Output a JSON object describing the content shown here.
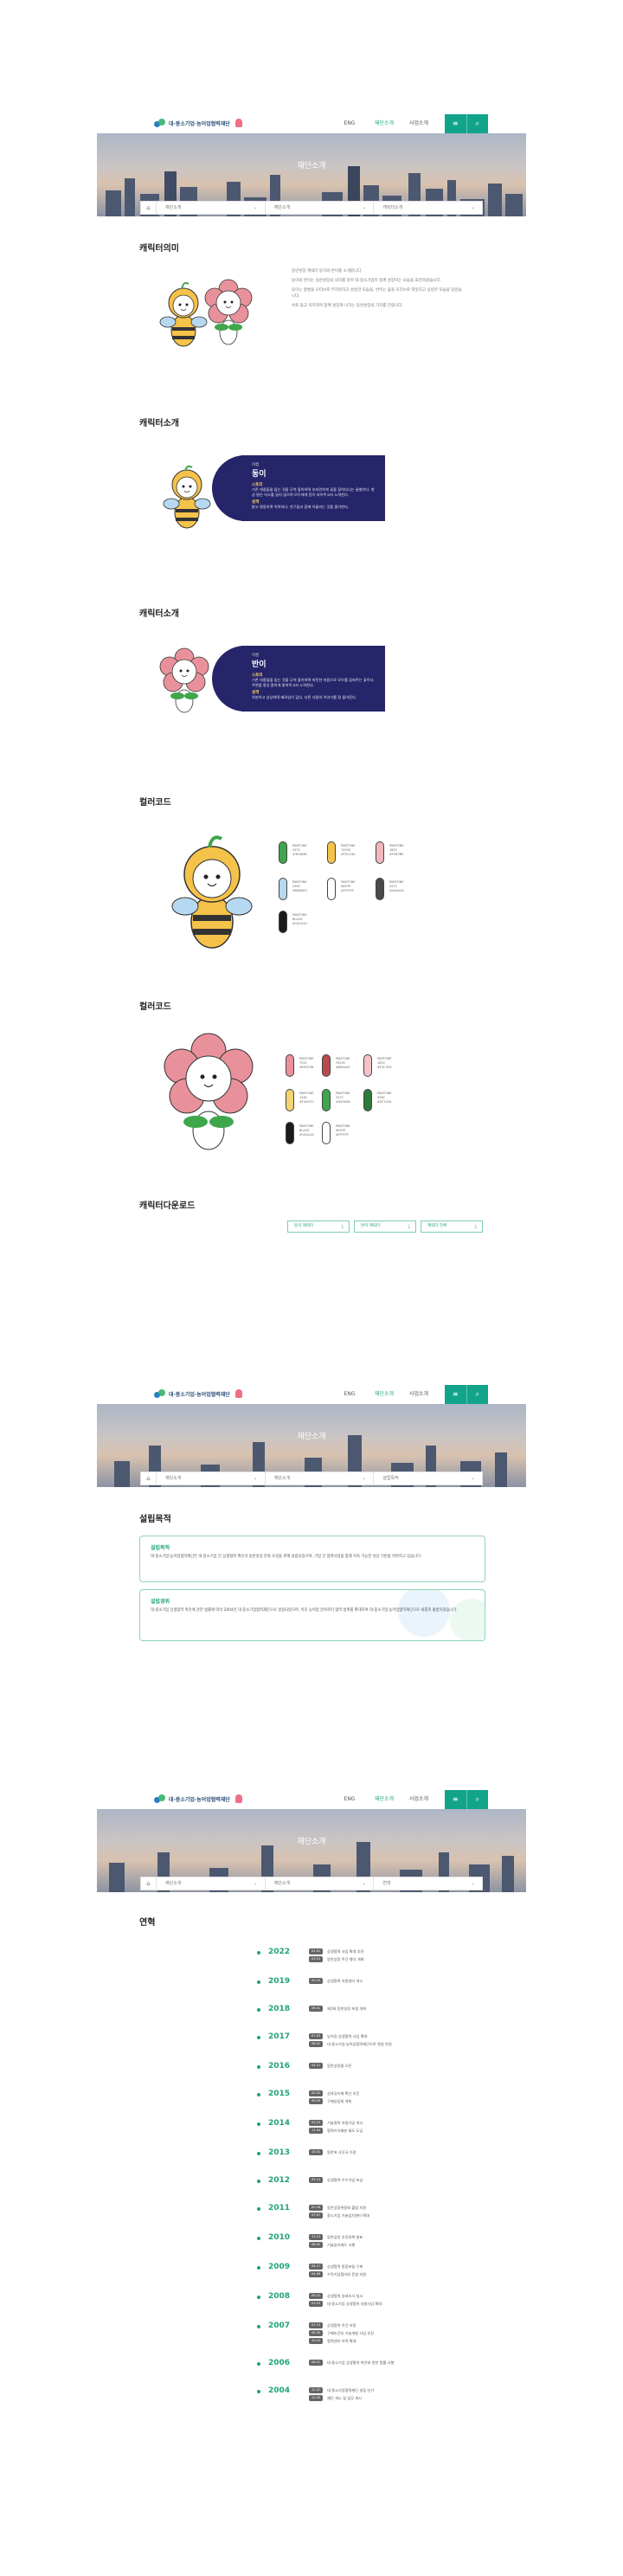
{
  "header": {
    "logo": "대·중소기업·농어업협력재단",
    "nav": [
      "ENG",
      "재단소개",
      "사업소개"
    ]
  },
  "hero": {
    "title": "재단소개"
  },
  "crumb": {
    "items": [
      "재단소개",
      "재단소개",
      "캐릭터소개"
    ]
  },
  "colors": {
    "accent": "#11a48b",
    "green_text": "#1fa37a",
    "navy": "#26256a"
  },
  "sections": {
    "meaning": "캐릭터의미",
    "intro1": "캐릭터소개",
    "intro2": "캐릭터소개",
    "color1": "컬러코드",
    "color2": "컬러코드",
    "download": "캐릭터다운로드",
    "purpose": "설립목적",
    "history": "연혁"
  },
  "meaning_paragraphs": [
    "동반성장 캐릭터 동이와 반이를 소개합니다.",
    "동이와 반이는 동반성장의 의미를 담아 대·중소기업이 함께 성장하는 모습을 표현하였습니다.",
    "동이는 꿀벌을 모티브로 부지런하고 성실한 모습을, 반이는 꽃을 모티브로 따뜻하고 상냥한 모습을 담았습니다.",
    "서로 돕고 의지하며 함께 성장해 나가는 동반성장의 가치를 전합니다."
  ],
  "intro": [
    {
      "tag": "이름",
      "name": "동이",
      "profile_label": "스토리",
      "profile": "기존 대중들을 돕는 것을 무척 좋아하며 부지런하게 꽃을 찾아다니는 꿀벌이다. 항상 밝은 미소를 잃지 않으며 모두에게 힘이 되어주고자 노력한다.",
      "char_label": "성격",
      "char": "밝고 명랑하며 씩씩하다. 친구들과 함께 어울리는 것을 좋아한다."
    },
    {
      "tag": "이름",
      "name": "반이",
      "profile_label": "스토리",
      "profile": "기존 대중들을 돕는 것을 무척 좋아하며 따뜻한 마음으로 모두를 감싸주는 꽃이다. 주변을 항상 환하게 밝혀주고자 노력한다.",
      "char_label": "성격",
      "char": "차분하고 상냥하며 배려심이 깊다. 다른 사람의 이야기를 잘 들어준다."
    }
  ],
  "color_codes_1": [
    {
      "hex": "#3ea64b",
      "text": [
        "PANTONE",
        "347C",
        "#3EA64B"
      ]
    },
    {
      "hex": "#f5c24a",
      "text": [
        "PANTONE",
        "7404C",
        "#F5C24A"
      ]
    },
    {
      "hex": "#f2b7be",
      "text": [
        "PANTONE",
        "182C",
        "#F2B7BE"
      ]
    },
    {
      "hex": "#b6d8f0",
      "text": [
        "PANTONE",
        "290C",
        "#B6D8F0"
      ]
    },
    {
      "hex": "#ffffff",
      "text": [
        "PANTONE",
        "WHITE",
        "#FFFFFF"
      ]
    },
    {
      "hex": "#4a4a4a",
      "text": [
        "PANTONE",
        "447C",
        "#4A4A4A"
      ]
    },
    {
      "hex": "#1a1a1a",
      "text": [
        "PANTONE",
        "BLACK",
        "#1A1A1A"
      ]
    }
  ],
  "color_codes_2": [
    {
      "hex": "#e9919b",
      "text": [
        "PANTONE",
        "701C",
        "#E9919B"
      ]
    },
    {
      "hex": "#b84a4e",
      "text": [
        "PANTONE",
        "7623C",
        "#B84A4E"
      ]
    },
    {
      "hex": "#f4c3c8",
      "text": [
        "PANTONE",
        "182C",
        "#F4C3C8"
      ]
    },
    {
      "hex": "#f4d470",
      "text": [
        "PANTONE",
        "128C",
        "#F4D470"
      ]
    },
    {
      "hex": "#3ea64b",
      "text": [
        "PANTONE",
        "347C",
        "#3EA64B"
      ]
    },
    {
      "hex": "#2f7a3a",
      "text": [
        "PANTONE",
        "356C",
        "#2F7A3A"
      ]
    },
    {
      "hex": "#1a1a1a",
      "text": [
        "PANTONE",
        "BLACK",
        "#1A1A1A"
      ]
    },
    {
      "hex": "#ffffff",
      "text": [
        "PANTONE",
        "WHITE",
        "#FFFFFF"
      ]
    }
  ],
  "downloads": [
    "동이 캐릭터",
    "반이 캐릭터",
    "캐릭터 전체"
  ],
  "crumb2": {
    "items": [
      "재단소개",
      "재단소개",
      "설립목적"
    ]
  },
  "purpose": [
    {
      "title": "설립목적",
      "text": "대·중소기업·농어업협력재단은 대·중소기업 간 상생협력 확산과 동반성장 문화 조성을 위해 설립되었으며, 기업 간 협력사업을 통해 지속 가능한 성장 기반을 마련하고 있습니다."
    },
    {
      "title": "설립경위",
      "text": "대·중소기업 상생협력 촉진에 관한 법률에 따라 2004년 대·중소기업협력재단으로 설립되었으며, 이후 농어업 분야까지 협력 범위를 확대하여 대·중소기업·농어업협력재단으로 새롭게 출범하였습니다."
    }
  ],
  "crumb3": {
    "items": [
      "재단소개",
      "재단소개",
      "연혁"
    ]
  },
  "history": [
    {
      "year": "2022",
      "entries": [
        {
          "m": "01.01",
          "t": "상생협력 사업 확대 추진"
        },
        {
          "m": "03.15",
          "t": "동반성장 주간 행사 개최"
        }
      ]
    },
    {
      "year": "2019",
      "entries": [
        {
          "m": "05.20",
          "t": "상생협력 지원센터 개소"
        }
      ]
    },
    {
      "year": "2018",
      "entries": [
        {
          "m": "06.01",
          "t": "제1회 동반성장 포럼 개최"
        }
      ]
    },
    {
      "year": "2017",
      "entries": [
        {
          "m": "07.03",
          "t": "농어업 상생협력 사업 확대"
        },
        {
          "m": "08.01",
          "t": "대·중소기업·농어업협력재단으로 명칭 변경"
        }
      ]
    },
    {
      "year": "2016",
      "entries": [
        {
          "m": "04.11",
          "t": "동반성장몰 오픈"
        }
      ]
    },
    {
      "year": "2015",
      "entries": [
        {
          "m": "02.02",
          "t": "성과공유제 확산 추진"
        },
        {
          "m": "09.09",
          "t": "구매상담회 개최"
        }
      ]
    },
    {
      "year": "2014",
      "entries": [
        {
          "m": "03.25",
          "t": "기술협력 지원사업 개시"
        },
        {
          "m": "11.04",
          "t": "협력이익배분 제도 도입"
        }
      ]
    },
    {
      "year": "2013",
      "entries": [
        {
          "m": "10.01",
          "t": "동반위 사무국 이관"
        }
      ]
    },
    {
      "year": "2012",
      "entries": [
        {
          "m": "05.14",
          "t": "상생협력 우수기업 포상"
        }
      ]
    },
    {
      "year": "2011",
      "entries": [
        {
          "m": "02.28",
          "t": "동반성장위원회 출범 지원"
        },
        {
          "m": "07.07",
          "t": "중소기업 기술임치센터 확대"
        }
      ]
    },
    {
      "year": "2010",
      "entries": [
        {
          "m": "12.13",
          "t": "동반성장 추진대책 발표"
        },
        {
          "m": "06.02",
          "t": "기술임치제도 시행"
        }
      ]
    },
    {
      "year": "2009",
      "entries": [
        {
          "m": "08.17",
          "t": "상생협력 종합포털 구축"
        },
        {
          "m": "04.06",
          "t": "수탁기업협의회 운영 지원"
        }
      ]
    },
    {
      "year": "2008",
      "entries": [
        {
          "m": "09.22",
          "t": "상생협력 실태조사 실시"
        },
        {
          "m": "03.03",
          "t": "대·중소기업 상생협력 지원사업 확대"
        }
      ]
    },
    {
      "year": "2007",
      "entries": [
        {
          "m": "01.15",
          "t": "상생협력 주간 지정"
        },
        {
          "m": "05.30",
          "t": "구매조건부 기술개발 사업 추진"
        },
        {
          "m": "10.10",
          "t": "협력센터 지역 확대"
        }
      ]
    },
    {
      "year": "2006",
      "entries": [
        {
          "m": "06.21",
          "t": "대·중소기업 상생협력 촉진에 관한 법률 시행"
        }
      ]
    },
    {
      "year": "2004",
      "entries": [
        {
          "m": "12.07",
          "t": "대·중소기업협력재단 설립 인가"
        },
        {
          "m": "12.29",
          "t": "재단 개소 및 업무 개시"
        }
      ]
    }
  ]
}
